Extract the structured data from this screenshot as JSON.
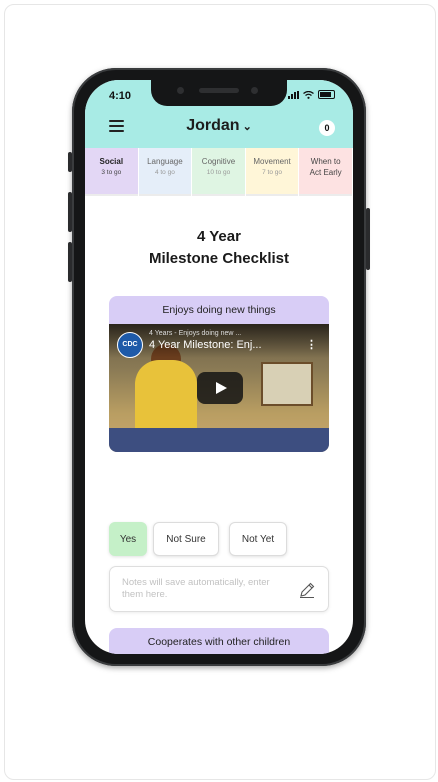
{
  "status": {
    "time": "4:10"
  },
  "header": {
    "child_name": "Jordan",
    "chevron": "⌄",
    "notification_count": "0"
  },
  "tabs": [
    {
      "label": "Social",
      "sub": "3 to go",
      "color": "#e3d7f5",
      "active": true
    },
    {
      "label": "Language",
      "sub": "4 to go",
      "color": "#e5eef9"
    },
    {
      "label": "Cognitive",
      "sub": "10 to go",
      "color": "#dff5e3"
    },
    {
      "label": "Movement",
      "sub": "7 to go",
      "color": "#fff6d8"
    },
    {
      "label": "When to",
      "label2": "Act Early",
      "color": "#fde2e2"
    }
  ],
  "page": {
    "title_line1": "4 Year",
    "title_line2": "Milestone Checklist"
  },
  "milestones": [
    {
      "heading": "Enjoys doing new things",
      "video": {
        "channel_logo": "CDC",
        "subtitle": "4 Years - Enjoys doing new ...",
        "title": "4 Year Milestone: Enj...",
        "more": "⋮"
      },
      "answers": {
        "yes": "Yes",
        "not_sure": "Not Sure",
        "not_yet": "Not Yet"
      },
      "notes_placeholder": "Notes will save automatically, enter them here."
    },
    {
      "heading": "Cooperates with other children"
    }
  ]
}
